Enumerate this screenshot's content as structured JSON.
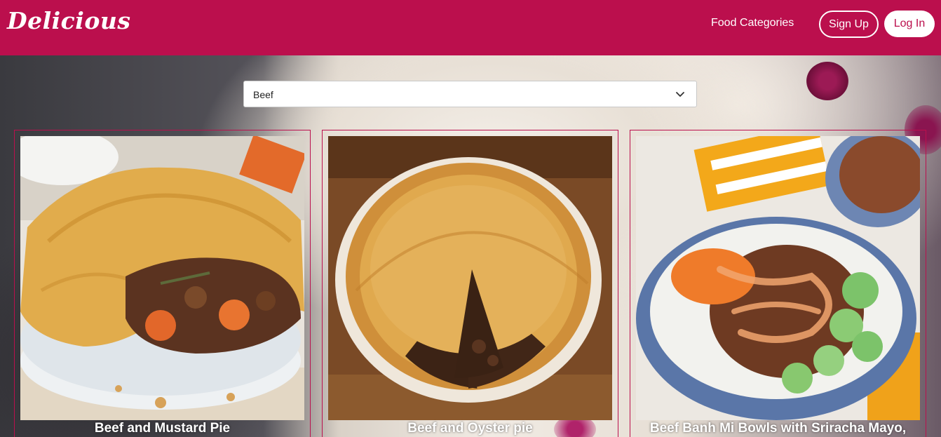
{
  "header": {
    "logo": "Delicious",
    "nav_link": "Food Categories",
    "signup_label": "Sign Up",
    "login_label": "Log In"
  },
  "filter": {
    "selected": "Beef"
  },
  "cards": [
    {
      "title": "Beef and Mustard Pie"
    },
    {
      "title": "Beef and Oyster pie"
    },
    {
      "title": "Beef Banh Mi Bowls with Sriracha Mayo,"
    }
  ],
  "colors": {
    "brand": "#bb0f4d",
    "white": "#ffffff"
  }
}
